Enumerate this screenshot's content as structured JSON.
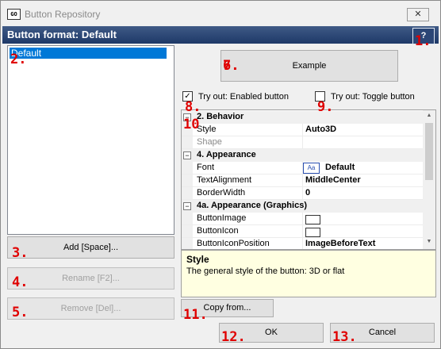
{
  "window": {
    "icon_text": "GO",
    "title": "Button Repository",
    "close_glyph": "✕"
  },
  "header": {
    "title": "Button format: Default",
    "help_label": "?"
  },
  "list": {
    "items": [
      "Default"
    ]
  },
  "buttons": {
    "example": "Example",
    "add": "Add [Space]...",
    "rename": "Rename [F2]...",
    "remove": "Remove [Del]...",
    "copy_from": "Copy from...",
    "ok": "OK",
    "cancel": "Cancel"
  },
  "checkboxes": {
    "enabled": {
      "label": "Try out: Enabled button",
      "checked": true,
      "glyph": "✓"
    },
    "toggle": {
      "label": "Try out: Toggle button",
      "checked": false
    }
  },
  "grid": {
    "toggle_glyph": "−",
    "categories": {
      "behavior": "2. Behavior",
      "appearance": "4. Appearance",
      "graphics": "4a. Appearance (Graphics)"
    },
    "props": {
      "style": {
        "name": "Style",
        "value": "Auto3D"
      },
      "shape": {
        "name": "Shape",
        "value": ""
      },
      "font": {
        "name": "Font",
        "value": "Default",
        "icon": "Aa"
      },
      "text_alignment": {
        "name": "TextAlignment",
        "value": "MiddleCenter"
      },
      "border_width": {
        "name": "BorderWidth",
        "value": "0"
      },
      "button_image": {
        "name": "ButtonImage",
        "value": ""
      },
      "button_icon": {
        "name": "ButtonIcon",
        "value": ""
      },
      "button_icon_position": {
        "name": "ButtonIconPosition",
        "value": "ImageBeforeText"
      }
    },
    "scroll_up": "▲",
    "scroll_down": "▼"
  },
  "description": {
    "title": "Style",
    "text": "The general style of the button: 3D or flat"
  },
  "markers": {
    "m1": "1.",
    "m2": "2.",
    "m3": "3.",
    "m4": "4.",
    "m5": "5.",
    "m6": "6.",
    "m7": "7.",
    "m8": "8.",
    "m9": "9.",
    "m10": "10",
    "m11": "11.",
    "m12": "12.",
    "m13": "13."
  },
  "colors": {
    "header_bg": "#1e3968",
    "selection": "#0078d7",
    "marker": "#e00000",
    "description_bg": "#ffffe1"
  }
}
